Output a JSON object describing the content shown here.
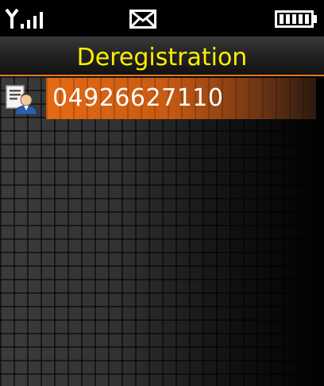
{
  "status_bar": {
    "icons": [
      "signal-icon",
      "message-envelope-icon",
      "battery-icon"
    ]
  },
  "title_bar": {
    "title": "Deregistration"
  },
  "list": {
    "items": [
      {
        "icon": "contact-card-icon",
        "label": "04926627110",
        "selected": true
      }
    ]
  },
  "colors": {
    "title_text": "#ffee00",
    "accent": "#e0791f",
    "highlight": "#e56a14",
    "item_text": "#ffffff",
    "background": "#000000"
  }
}
